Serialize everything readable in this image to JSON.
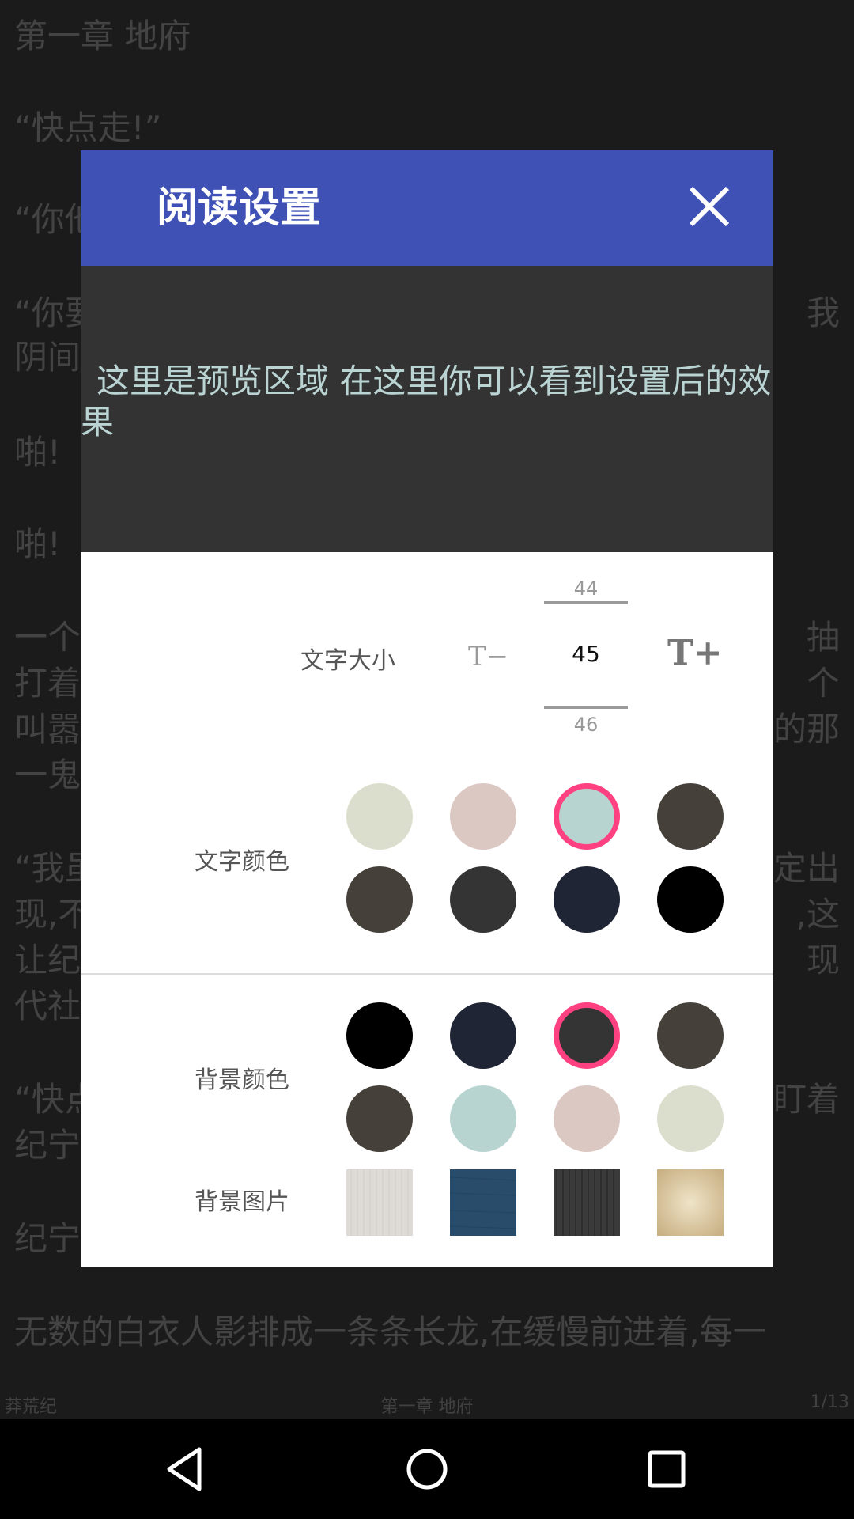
{
  "reader": {
    "lines": [
      "第一章 地府",
      "“快点走!”",
      " “你他",
      " “你要",
      "阴间",
      " 啪!",
      " 啪!",
      " 一个",
      "打着",
      "叫嚣",
      "一鬼",
      " “我虽",
      "现,不",
      "让纪",
      "代社",
      " “快点",
      "纪宁",
      " 纪宁",
      " 无数的白衣人影排成一条条长龙,在缓慢前进着,每一"
    ],
    "right_lines": [
      "我",
      "抽",
      "个",
      "的那",
      "定出",
      ",这",
      "现",
      "盯着"
    ],
    "footer_left": "莽荒纪",
    "footer_center": "第一章 地府",
    "footer_right": "1/13"
  },
  "dialog": {
    "title": "阅读设置",
    "close_icon": "close-icon",
    "preview_text": "这里是预览区域 在这里你可以看到设置后的效果",
    "text_size": {
      "label": "文字大小",
      "decrease_label": "T−",
      "increase_label": "T+",
      "prev_value": "44",
      "current_value": "45",
      "next_value": "46"
    },
    "text_color": {
      "label": "文字颜色",
      "swatches": [
        "#dcdecd",
        "#dbc8c3",
        "#b8d4d1",
        "#454039",
        "#454039",
        "#343434",
        "#1f2535",
        "#000000"
      ],
      "selected_index": 2
    },
    "bg_color": {
      "label": "背景颜色",
      "swatches": [
        "#000000",
        "#1f2535",
        "#343434",
        "#454039",
        "#454039",
        "#b8d4d1",
        "#dbc8c3",
        "#dcdecd"
      ],
      "selected_index": 2
    },
    "bg_image": {
      "label": "背景图片",
      "images": [
        "light-paper-texture",
        "blue-fabric-texture",
        "dark-stripe-texture",
        "old-paper-texture"
      ]
    }
  },
  "navbar": {
    "icons": [
      "back-triangle-icon",
      "home-circle-icon",
      "recents-square-icon"
    ]
  }
}
